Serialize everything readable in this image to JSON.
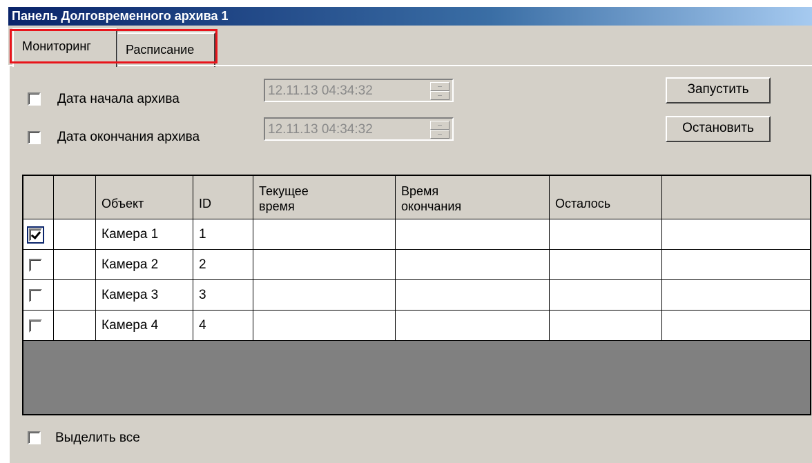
{
  "window": {
    "title": "Панель Долговременного архива 1"
  },
  "tabs": [
    {
      "label": "Мониторинг",
      "active": true
    },
    {
      "label": "Расписание",
      "active": false
    }
  ],
  "filters": {
    "start": {
      "label": "Дата начала архива",
      "checked": false,
      "value": "12.11.13 04:34:32"
    },
    "end": {
      "label": "Дата окончания архива",
      "checked": false,
      "value": "12.11.13 04:34:32"
    }
  },
  "buttons": {
    "start": "Запустить",
    "stop": "Остановить"
  },
  "table": {
    "columns": [
      "",
      "",
      "Объект",
      "ID",
      "Текущее время",
      "Время окончания",
      "Осталось",
      ""
    ],
    "header_lines": {
      "object": "Объект",
      "id": "ID",
      "current_1": "Текущее",
      "current_2": "время",
      "end_1": "Время",
      "end_2": "окончания",
      "remaining": "Осталось"
    },
    "rows": [
      {
        "checked": true,
        "object": "Камера 1",
        "id": "1",
        "current": "",
        "end": "",
        "remaining": ""
      },
      {
        "checked": false,
        "object": "Камера 2",
        "id": "2",
        "current": "",
        "end": "",
        "remaining": ""
      },
      {
        "checked": false,
        "object": "Камера 3",
        "id": "3",
        "current": "",
        "end": "",
        "remaining": ""
      },
      {
        "checked": false,
        "object": "Камера 4",
        "id": "4",
        "current": "",
        "end": "",
        "remaining": ""
      }
    ]
  },
  "select_all": {
    "label": "Выделить все",
    "checked": false
  },
  "colors": {
    "title_bar": "#0a246a",
    "face": "#d4d0c8",
    "highlight_frame": "#e8141b",
    "grid_empty": "#808080"
  }
}
